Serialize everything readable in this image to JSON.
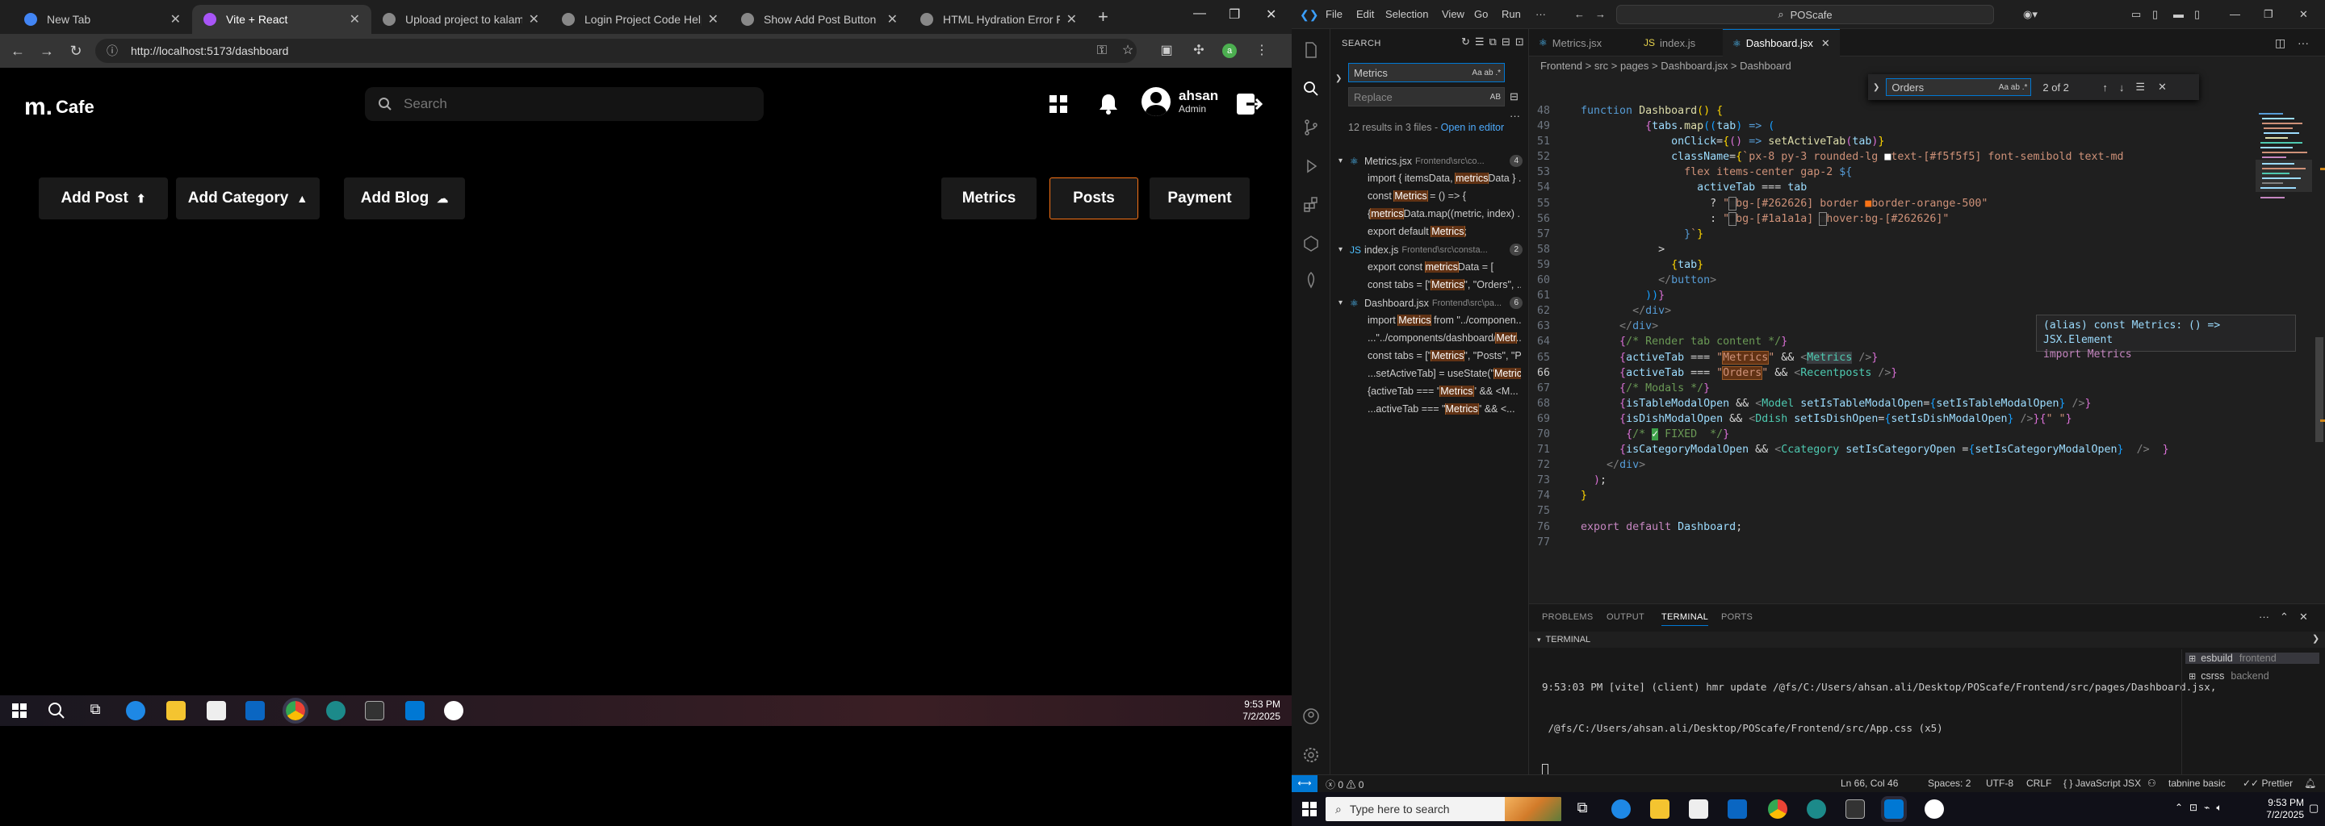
{
  "browser": {
    "tabs": [
      {
        "title": "New Tab",
        "color": "#4285f4"
      },
      {
        "title": "Vite + React",
        "color": "#a855f7"
      },
      {
        "title": "Upload project to kalams.org",
        "color": "#cccccc"
      },
      {
        "title": "Login Project Code Help",
        "color": "#cccccc"
      },
      {
        "title": "Show Add Post Button",
        "color": "#cccccc"
      },
      {
        "title": "HTML Hydration Error Fix",
        "color": "#cccccc"
      }
    ],
    "active_tab": 1,
    "url": "http://localhost:5173/dashboard"
  },
  "app": {
    "logo_mark": "m.",
    "logo_text": "Cafe",
    "search_placeholder": "Search",
    "user_name": "ahsan",
    "user_role": "Admin",
    "action_buttons": [
      "Add Post",
      "Add Category",
      "Add Blog"
    ],
    "tabs": [
      "Metrics",
      "Posts",
      "Payment"
    ],
    "active_tab": "Posts",
    "accent": "#f97316"
  },
  "left_taskbar": {
    "time": "9:53 PM",
    "date": "7/2/2025"
  },
  "vscode": {
    "menu": [
      "File",
      "Edit",
      "Selection",
      "View",
      "Go",
      "Run",
      "···"
    ],
    "command_center": "POScafe",
    "search": {
      "title": "SEARCH",
      "query": "Metrics",
      "replace_placeholder": "Replace",
      "replace_btn": "AB",
      "results_text": "12 results in 3 files - ",
      "open_in_editor": "Open in editor",
      "files": [
        {
          "name": "Metrics.jsx",
          "path": "Frontend\\src\\co...",
          "count": "4",
          "matches": [
            {
              "pre": "import { itemsData, ",
              "hit": "metrics",
              "post": "Data } ..."
            },
            {
              "pre": "const ",
              "hit": "Metrics",
              "post": " = () => {"
            },
            {
              "pre": "{",
              "hit": "metrics",
              "post": "Data.map((metric, index) ..."
            },
            {
              "pre": "export default ",
              "hit": "Metrics",
              "post": ";"
            }
          ]
        },
        {
          "name": "index.js",
          "path": "Frontend\\src\\consta...",
          "count": "2",
          "matches": [
            {
              "pre": "export const ",
              "hit": "metrics",
              "post": "Data = ["
            },
            {
              "pre": "const tabs = [\"",
              "hit": "Metrics",
              "post": "\", \"Orders\", ..."
            }
          ]
        },
        {
          "name": "Dashboard.jsx",
          "path": "Frontend\\src\\pa...",
          "count": "6",
          "matches": [
            {
              "pre": "import ",
              "hit": "Metrics",
              "post": " from \"../componen..."
            },
            {
              "pre": "...\"../components/dashboard/",
              "hit": "Metr",
              "post": "..."
            },
            {
              "pre": "const tabs = [\"",
              "hit": "Metrics",
              "post": "\", \"Posts\", \"P..."
            },
            {
              "pre": "...setActiveTab] = useState(\"",
              "hit": "Metric",
              "post": "..."
            },
            {
              "pre": "{activeTab === \"",
              "hit": "Metrics",
              "post": "\" && <M..."
            },
            {
              "pre": "...activeTab === \"",
              "hit": "Metrics",
              "post": "\" && <..."
            }
          ]
        }
      ]
    },
    "editor_tabs": [
      "Metrics.jsx",
      "index.js",
      "Dashboard.jsx"
    ],
    "active_editor_tab": "Dashboard.jsx",
    "breadcrumbs": "Frontend  >  src  >  pages  >  Dashboard.jsx  >  Dashboard",
    "find": {
      "query": "Orders",
      "count": "2 of 2"
    },
    "hover": {
      "line1": "(alias) const Metrics: () => JSX.Element",
      "line2": "import Metrics"
    },
    "panel_tabs": [
      "PROBLEMS",
      "OUTPUT",
      "TERMINAL",
      "PORTS"
    ],
    "terminal_label": "TERMINAL",
    "terminal_lines": [
      "9:53:03 PM [vite] (client) hmr update /@fs/C:/Users/ahsan.ali/Desktop/POScafe/Frontend/src/pages/Dashboard.jsx,",
      " /@fs/C:/Users/ahsan.ali/Desktop/POScafe/Frontend/src/App.css (x5)"
    ],
    "terminals": [
      {
        "name": "esbuild",
        "sub": "frontend"
      },
      {
        "name": "csrss",
        "sub": "backend"
      }
    ],
    "status": {
      "errors": "0",
      "warnings": "0",
      "position": "Ln 66, Col 46",
      "spaces": "Spaces: 2",
      "encoding": "UTF-8",
      "eol": "CRLF",
      "language": "JavaScript JSX",
      "tabnine": "tabnine basic",
      "prettier": "Prettier"
    }
  },
  "right_taskbar": {
    "search_placeholder": "Type here to search",
    "time": "9:53 PM",
    "date": "7/2/2025"
  }
}
